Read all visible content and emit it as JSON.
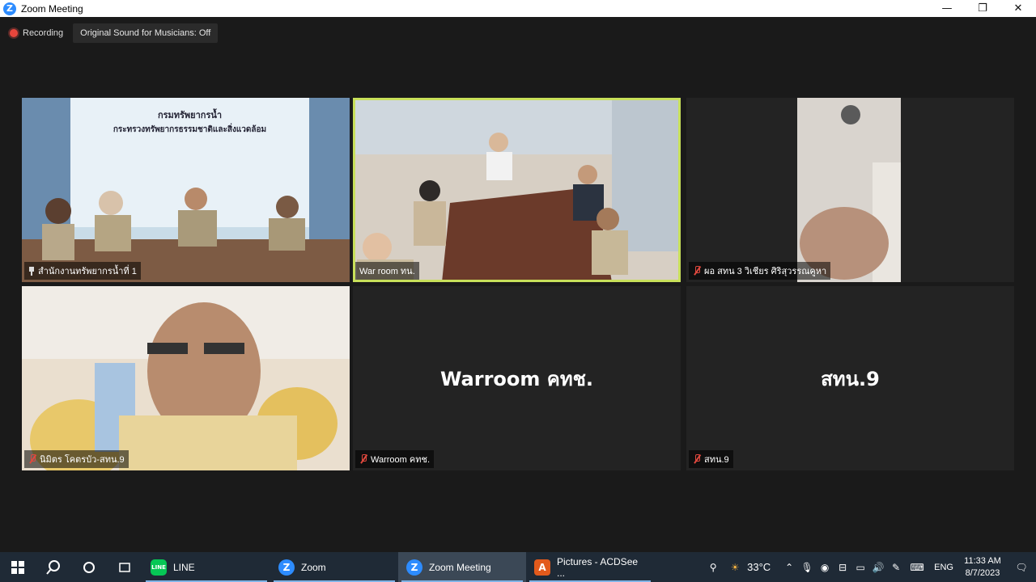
{
  "window": {
    "title": "Zoom Meeting",
    "logo_letter": "Z",
    "minimize": "—",
    "restore": "❐",
    "close": "✕"
  },
  "meeting": {
    "recording_label": "Recording",
    "sound_label": "Original Sound for Musicians: Off"
  },
  "tiles": [
    {
      "name": "สำนักงานทรัพยากรน้ำที่ 1",
      "pinned": true,
      "muted": false,
      "banner_line1": "กรมทรัพยากรน้ำ",
      "banner_line2": "กระทรวงทรัพยากรธรรมชาติและสิ่งแวดล้อม"
    },
    {
      "name": "War room ทน.",
      "active": true
    },
    {
      "name": "ผอ สทน 3 วิเชียร ศิริสุวรรณคูหา",
      "muted": true
    },
    {
      "name": "นิมิตร โคตรบัว-สทน.9",
      "muted": true
    },
    {
      "name": "Warroom คทช.",
      "muted": true,
      "display": "Warroom คทช."
    },
    {
      "name": "สทน.9",
      "muted": true,
      "display": "สทน.9"
    }
  ],
  "taskbar": {
    "apps": [
      {
        "label": "LINE",
        "icon": "LINE",
        "color": "#06c755"
      },
      {
        "label": "Zoom",
        "icon": "Z",
        "color": "#2d8cff"
      },
      {
        "label": "Zoom Meeting",
        "icon": "Z",
        "color": "#2d8cff"
      },
      {
        "label": "Pictures - ACDSee ...",
        "icon": "A",
        "color": "#e25a1c"
      }
    ],
    "weather": "33°C",
    "language": "ENG",
    "time": "11:33 AM",
    "date": "8/7/2023"
  }
}
